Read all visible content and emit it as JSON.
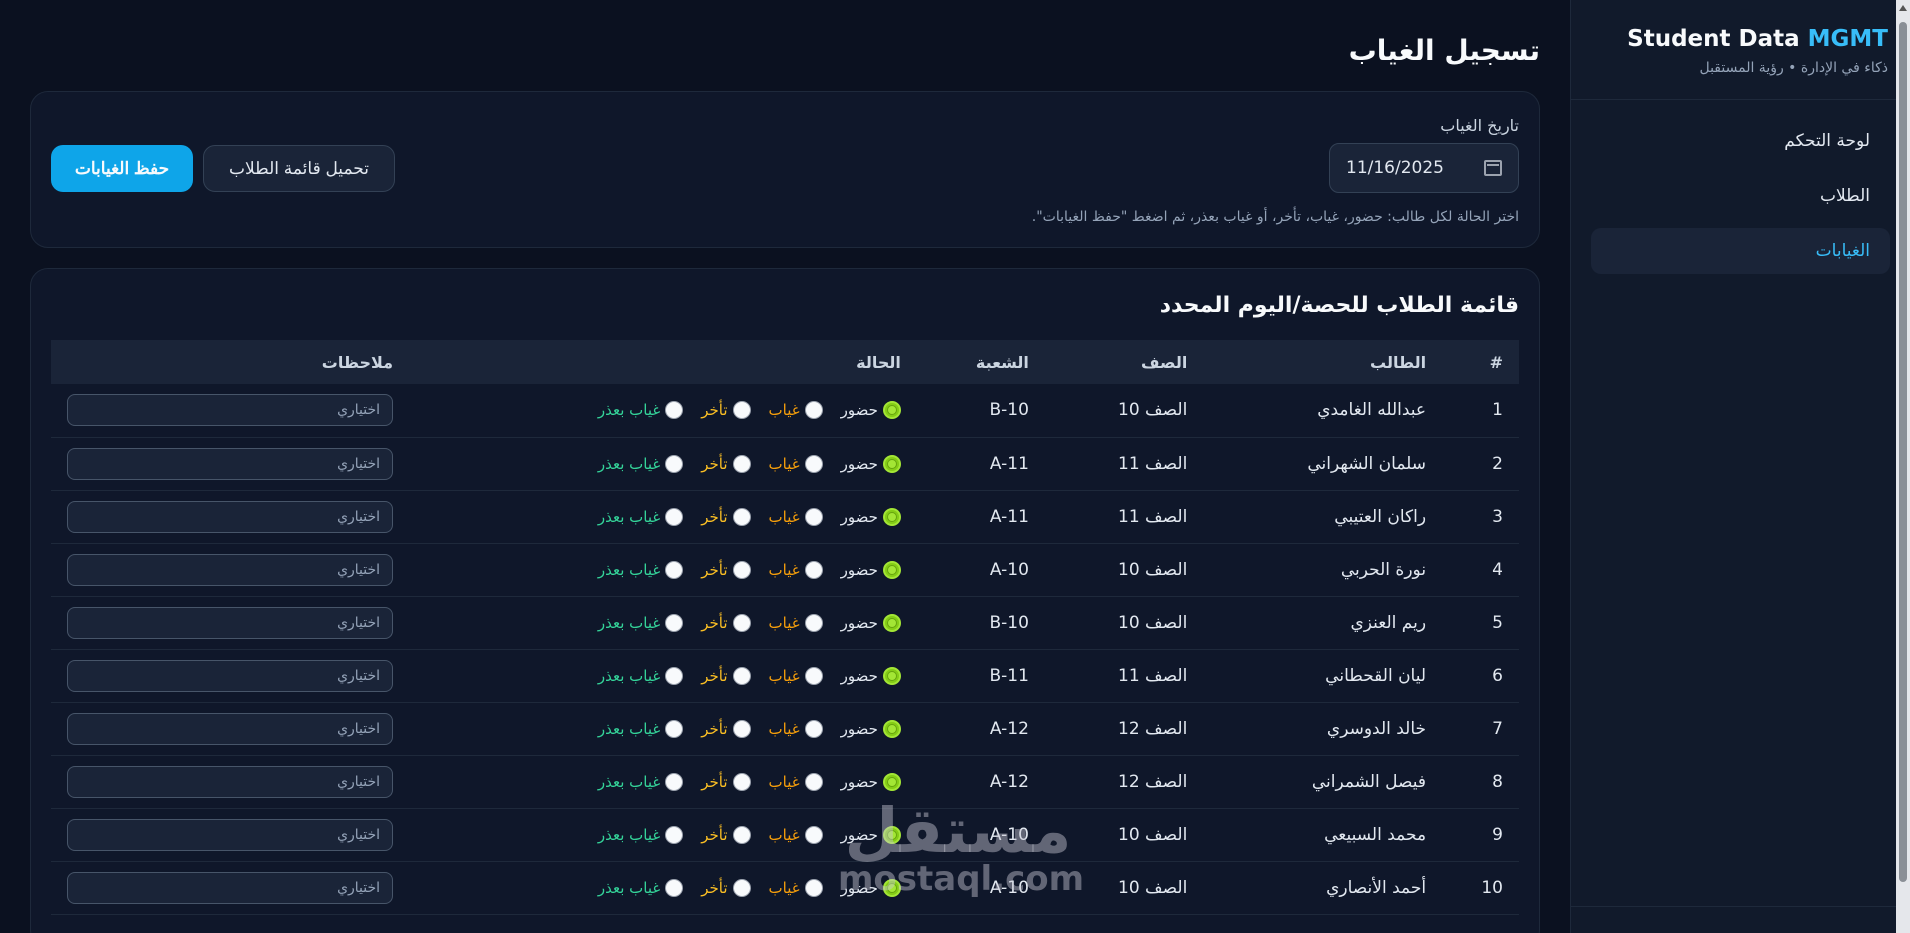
{
  "brand": {
    "title_main": "Student Data",
    "title_accent": "MGMT",
    "subtitle": "ذكاء في الإدارة • رؤية المستقبل"
  },
  "nav": {
    "items": [
      {
        "label": "لوحة التحكم",
        "active": false
      },
      {
        "label": "الطلاب",
        "active": false
      },
      {
        "label": "الغيابات",
        "active": true
      }
    ]
  },
  "page": {
    "title": "تسجيل الغياب"
  },
  "filter": {
    "date_label": "تاريخ الغياب",
    "date_value": "11/16/2025",
    "hint": "اختر الحالة لكل طالب: حضور، غياب، تأخر، أو غياب بعذر، ثم اضغط \"حفظ الغيابات\".",
    "load_button": "تحميل قائمة الطلاب",
    "save_button": "حفظ الغيابات"
  },
  "table": {
    "title": "قائمة الطلاب للحصة/اليوم المحدد",
    "headers": {
      "num": "#",
      "name": "الطالب",
      "grade": "الصف",
      "section": "الشعبة",
      "status": "الحالة",
      "notes": "ملاحظات"
    },
    "status_options": {
      "present": "حضور",
      "absent": "غياب",
      "late": "تأخر",
      "excused": "غياب بعذر"
    },
    "notes_placeholder": "اختياري",
    "rows": [
      {
        "num": "1",
        "name": "عبدالله الغامدي",
        "grade": "الصف 10",
        "section": "B-10",
        "status": "present"
      },
      {
        "num": "2",
        "name": "سلمان الشهراني",
        "grade": "الصف 11",
        "section": "A-11",
        "status": "present"
      },
      {
        "num": "3",
        "name": "راكان العتيبي",
        "grade": "الصف 11",
        "section": "A-11",
        "status": "present"
      },
      {
        "num": "4",
        "name": "نورة الحربي",
        "grade": "الصف 10",
        "section": "A-10",
        "status": "present"
      },
      {
        "num": "5",
        "name": "ريم العنزي",
        "grade": "الصف 10",
        "section": "B-10",
        "status": "present"
      },
      {
        "num": "6",
        "name": "ليان القحطاني",
        "grade": "الصف 11",
        "section": "B-11",
        "status": "present"
      },
      {
        "num": "7",
        "name": "خالد الدوسري",
        "grade": "الصف 12",
        "section": "A-12",
        "status": "present"
      },
      {
        "num": "8",
        "name": "فيصل الشمراني",
        "grade": "الصف 12",
        "section": "A-12",
        "status": "present"
      },
      {
        "num": "9",
        "name": "محمد السبيعي",
        "grade": "الصف 10",
        "section": "A-10",
        "status": "present"
      },
      {
        "num": "10",
        "name": "أحمد الأنصاري",
        "grade": "الصف 10",
        "section": "A-10",
        "status": "present"
      }
    ]
  },
  "watermark": {
    "arabic": "مستقل",
    "latin": "mostaql.com"
  },
  "colors": {
    "accent": "#38bdf8",
    "button_primary": "#0ea5e9",
    "present": "#84cc16",
    "absent": "#f59e0b",
    "excused": "#34d399"
  }
}
